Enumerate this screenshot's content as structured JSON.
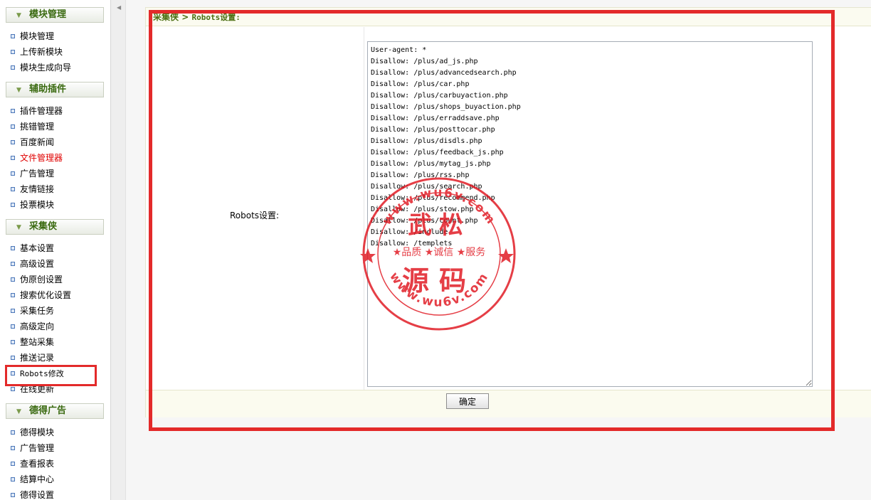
{
  "sidebar": {
    "sections": [
      {
        "title": "模块管理",
        "items": [
          "模块管理",
          "上传新模块",
          "模块生成向导"
        ]
      },
      {
        "title": "辅助插件",
        "items": [
          "插件管理器",
          "挑错管理",
          "百度新闻",
          "文件管理器",
          "广告管理",
          "友情链接",
          "投票模块"
        ]
      },
      {
        "title": "采集侠",
        "items": [
          "基本设置",
          "高级设置",
          "伪原创设置",
          "搜索优化设置",
          "采集任务",
          "高级定向",
          "整站采集",
          "推送记录",
          "Robots修改",
          "在线更新"
        ]
      },
      {
        "title": "德得广告",
        "items": [
          "德得模块",
          "广告管理",
          "查看报表",
          "结算中心",
          "德得设置"
        ]
      }
    ],
    "active_item": "文件管理器",
    "highlighted_item": "Robots修改"
  },
  "breadcrumb": {
    "section": "采集侠",
    "separator": ">",
    "page": "Robots设置:"
  },
  "form": {
    "label": "Robots设置:",
    "robots_text": "User-agent: *\nDisallow: /plus/ad_js.php\nDisallow: /plus/advancedsearch.php\nDisallow: /plus/car.php\nDisallow: /plus/carbuyaction.php\nDisallow: /plus/shops_buyaction.php\nDisallow: /plus/erraddsave.php\nDisallow: /plus/posttocar.php\nDisallow: /plus/disdls.php\nDisallow: /plus/feedback_js.php\nDisallow: /plus/mytag_js.php\nDisallow: /plus/rss.php\nDisallow: /plus/search.php\nDisallow: /plus/recommend.php\nDisallow: /plus/stow.php\nDisallow: /plus/count.php\nDisallow: /include\nDisallow: /templets",
    "submit_label": "确定"
  },
  "watermark": {
    "url_text": "www.wu6v.com",
    "name_top": "武松",
    "slogan": "★品质 ★诚信 ★服务",
    "name_bottom": "源码",
    "color": "#e0141e"
  },
  "colors": {
    "highlight": "#e32a2a",
    "section_title": "#3a6a10",
    "active_link": "#e00000"
  }
}
